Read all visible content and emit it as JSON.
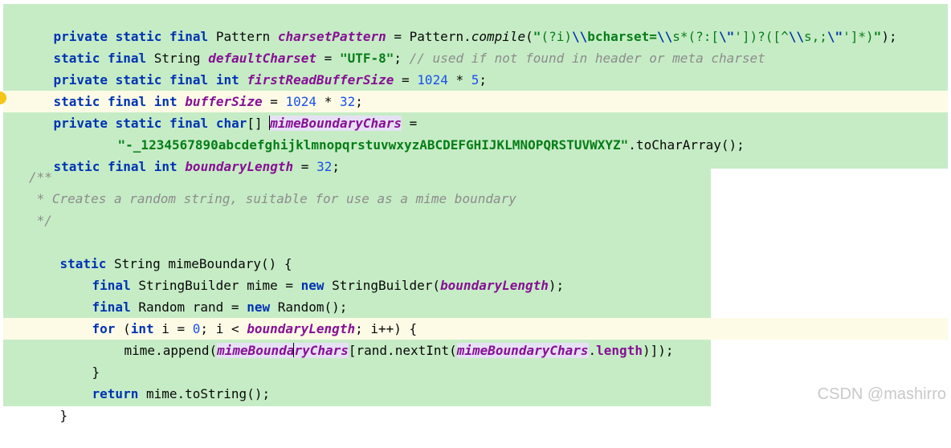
{
  "code": {
    "l1": {
      "kw": "private static final",
      "type": " Pattern ",
      "name": "charsetPattern",
      "eq": " = Pattern.",
      "call": "compile",
      "open": "(",
      "q1": "\"",
      "re1": "(?i)",
      "esc1": "\\\\",
      "re2": "bcharset=",
      "esc2": "\\\\",
      "re3": "s*(?:[",
      "esc3": "\\\"",
      "re4": "'])?([^",
      "esc4": "\\\\",
      "re5": "s,;",
      "esc5": "\\\"",
      "re6": "']*)",
      "q2": "\"",
      "end": ");"
    },
    "l2": {
      "kw": "static final",
      "type": " String ",
      "name": "defaultCharset",
      "eq": " = ",
      "str": "\"UTF-8\"",
      "semi": "; ",
      "comment": "// used if not found in header or meta charset"
    },
    "l3": {
      "kw": "private static final int",
      "sp": " ",
      "name": "firstReadBufferSize",
      "eq": " = ",
      "n1": "1024",
      "op": " * ",
      "n2": "5",
      "semi": ";"
    },
    "l4": {
      "kw": "static final int",
      "sp": " ",
      "name": "bufferSize",
      "eq": " = ",
      "n1": "1024",
      "op": " * ",
      "n2": "32",
      "semi": ";"
    },
    "l5": {
      "kw": "private static final char",
      "type": "[] ",
      "name": "mimeBoundaryChars",
      "eq": " ="
    },
    "l6": {
      "str": "\"-_1234567890abcdefghijklmnopqrstuvwxyzABCDEFGHIJKLMNOPQRSTUVWXYZ\"",
      "rest": ".toCharArray();"
    },
    "l7": {
      "kw": "static final int",
      "sp": " ",
      "name": "boundaryLength",
      "eq": " = ",
      "n": "32",
      "semi": ";"
    },
    "l8": {
      "comment": "/**"
    },
    "l9": {
      "comment": " * Creates a random string, suitable for use as a mime boundary"
    },
    "l10": {
      "comment": " */"
    },
    "l11": {
      "kw": "static",
      "rest": " String mimeBoundary() {"
    },
    "l12": {
      "kw": "final",
      "mid": " StringBuilder mime = ",
      "kw2": "new",
      "call": " StringBuilder(",
      "fld": "boundaryLength",
      "end": ");"
    },
    "l13": {
      "kw": "final",
      "mid": " Random rand = ",
      "kw2": "new",
      "end": " Random();"
    },
    "l14": {
      "kw": "for",
      "p1": " (",
      "kw2": "int",
      "p2": " i = ",
      "n": "0",
      "p3": "; i < ",
      "fld": "boundaryLength",
      "p4": "; i++) {"
    },
    "l15": {
      "pre": "mime.append(",
      "fld1a": "mimeBounda",
      "fld1b": "ryChars",
      "mid": "[rand.nextInt(",
      "fld2": "mimeBoundaryChars",
      "dot": ".",
      "len": "length",
      "end": ")]);"
    },
    "l16": {
      "text": "}"
    },
    "l17": {
      "kw": "return",
      "rest": " mime.toString();"
    },
    "l18": {
      "text": "}"
    }
  },
  "watermark": "CSDN @mashirro",
  "colors": {
    "keyword": "#0033b3",
    "field": "#871094",
    "string": "#067d17",
    "number": "#1750eb",
    "comment": "#8c8c8c",
    "added_line_bg": "#c6ecc6",
    "current_line_bg": "#fdfbe6"
  }
}
